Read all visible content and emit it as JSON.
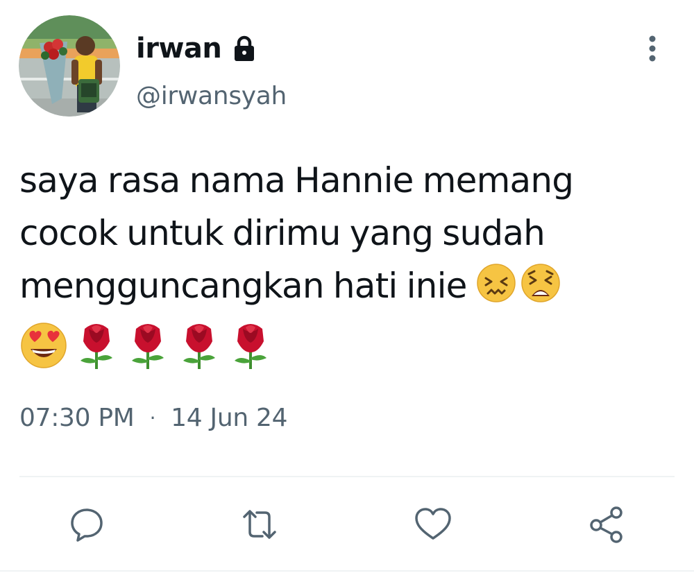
{
  "user": {
    "display_name": "irwan",
    "handle": "@irwansyah",
    "protected": true,
    "avatar_icon": "profile-photo"
  },
  "tweet": {
    "text_lines": [
      "saya rasa nama Hannie memang",
      "cocok untuk dirimu yang sudah",
      "mengguncangkan hati inie"
    ],
    "inline_emojis": [
      "confounded-face",
      "tired-face"
    ],
    "emojis_line": [
      "smiling-face-with-heart-eyes",
      "rose",
      "rose",
      "rose",
      "rose"
    ],
    "time": "07:30 PM",
    "separator": "·",
    "date": "14 Jun 24"
  },
  "actions": {
    "icons": [
      "reply-icon",
      "retweet-icon",
      "like-icon",
      "share-icon"
    ]
  },
  "colors": {
    "text_primary": "#0f1419",
    "text_secondary": "#536471",
    "divider": "#eff3f4",
    "rose": "#c8102e"
  }
}
